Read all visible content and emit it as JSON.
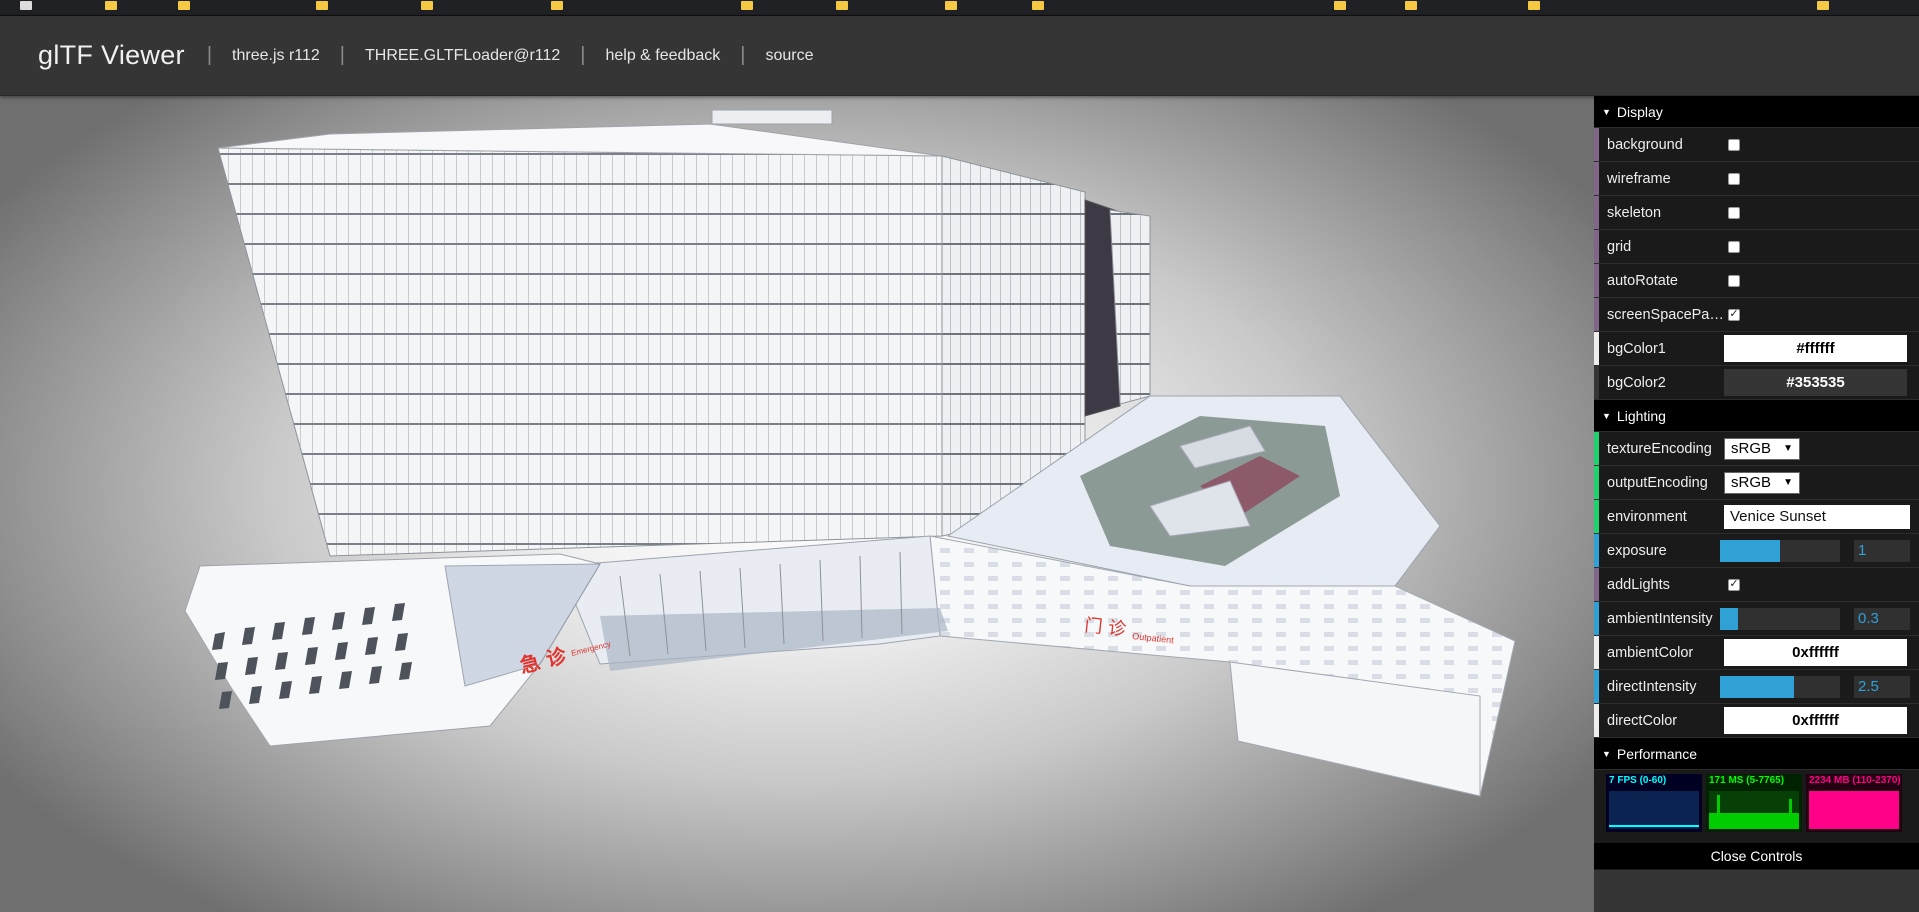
{
  "header": {
    "title": "glTF Viewer",
    "links": [
      "three.js r112",
      "THREE.GLTFLoader@r112",
      "help & feedback",
      "source"
    ]
  },
  "controls": {
    "display": {
      "title": "Display",
      "background": "background",
      "wireframe": "wireframe",
      "skeleton": "skeleton",
      "grid": "grid",
      "autoRotate": "autoRotate",
      "screenSpacePanning": "screenSpacePan...",
      "bgColor1_label": "bgColor1",
      "bgColor1_value": "#ffffff",
      "bgColor2_label": "bgColor2",
      "bgColor2_value": "#353535"
    },
    "lighting": {
      "title": "Lighting",
      "textureEncoding_label": "textureEncoding",
      "textureEncoding_value": "sRGB",
      "outputEncoding_label": "outputEncoding",
      "outputEncoding_value": "sRGB",
      "environment_label": "environment",
      "environment_value": "Venice Sunset",
      "exposure_label": "exposure",
      "exposure_value": "1",
      "addLights_label": "addLights",
      "ambientIntensity_label": "ambientIntensity",
      "ambientIntensity_value": "0.3",
      "ambientColor_label": "ambientColor",
      "ambientColor_value": "0xffffff",
      "directIntensity_label": "directIntensity",
      "directIntensity_value": "2.5",
      "directColor_label": "directColor",
      "directColor_value": "0xffffff"
    },
    "performance": {
      "title": "Performance",
      "fps": "7 FPS (0-60)",
      "ms": "171 MS (5-7765)",
      "mb": "2234 MB (110-2370)"
    },
    "close_label": "Close Controls"
  },
  "scene": {
    "sign_emergency_cn": "急 诊",
    "sign_emergency_en": "Emergency",
    "sign_outpatient_cn": "门 诊",
    "sign_outpatient_en": "Outpatient"
  },
  "colors": {
    "accent_number": "#2fa1d6",
    "accent_boolean": "#806787",
    "accent_string": "#1ed36f",
    "fps_color": "#00c8ff",
    "ms_color": "#00ff22",
    "mb_color": "#ff0088",
    "sign_red": "#e0342c"
  }
}
